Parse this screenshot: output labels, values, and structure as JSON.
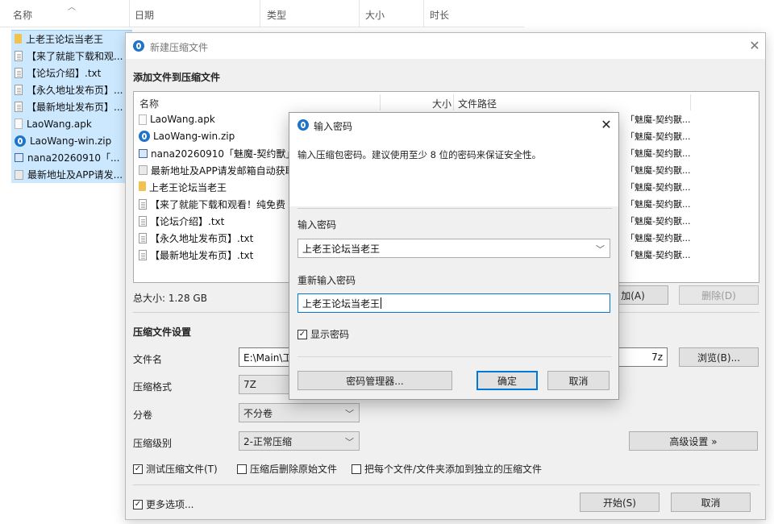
{
  "explorer": {
    "columns": [
      "名称",
      "日期",
      "类型",
      "大小",
      "时长"
    ],
    "files": [
      {
        "name": "上老王论坛当老王",
        "icon": "folder-icon"
      },
      {
        "name": "【来了就能下载和观...",
        "icon": "text-file-icon"
      },
      {
        "name": "【论坛介绍】.txt",
        "icon": "text-file-icon"
      },
      {
        "name": "【永久地址发布页】...",
        "icon": "text-file-icon"
      },
      {
        "name": "【最新地址发布页】...",
        "icon": "text-file-icon"
      },
      {
        "name": "LaoWang.apk",
        "icon": "apk-file-icon"
      },
      {
        "name": "LaoWang-win.zip",
        "icon": "zip-icon"
      },
      {
        "name": "nana20260910「...",
        "icon": "image-file-icon"
      },
      {
        "name": "最新地址及APP请发...",
        "icon": "image-file-icon"
      }
    ]
  },
  "main_window": {
    "title": "新建压缩文件",
    "add_files_heading": "添加文件到压缩文件",
    "list_columns": {
      "name": "名称",
      "size": "大小",
      "path": "文件路径"
    },
    "files": [
      {
        "name": "LaoWang.apk",
        "path": "「魅魔-契约獸...",
        "icon": "apk-file-icon"
      },
      {
        "name": "LaoWang-win.zip",
        "path": "「魅魔-契约獸...",
        "icon": "zip-icon"
      },
      {
        "name": "nana20260910「魅魔-契约獸」",
        "path": "「魅魔-契约獸...",
        "icon": "image-file-icon"
      },
      {
        "name": "最新地址及APP请发邮箱自动获取",
        "path": "「魅魔-契约獸...",
        "icon": "image-file-icon"
      },
      {
        "name": "上老王论坛当老王",
        "path": "「魅魔-契约獸...",
        "icon": "folder-icon"
      },
      {
        "name": "【来了就能下载和观看！纯免费",
        "path": "「魅魔-契约獸...",
        "icon": "text-file-icon"
      },
      {
        "name": "【论坛介绍】.txt",
        "path": "「魅魔-契约獸...",
        "icon": "text-file-icon"
      },
      {
        "name": "【永久地址发布页】.txt",
        "path": "「魅魔-契约獸...",
        "icon": "text-file-icon"
      },
      {
        "name": "【最新地址发布页】.txt",
        "path": "「魅魔-契约獸...",
        "icon": "text-file-icon"
      }
    ],
    "total_size": "总大小: 1.28 GB",
    "add_button": "加(A)",
    "delete_button": "删除(D)",
    "settings_heading": "压缩文件设置",
    "filename_label": "文件名",
    "filename_value": "E:\\Main\\工",
    "filename_value_tail": "7z",
    "browse_button": "浏览(B)...",
    "format_label": "压缩格式",
    "format_value": "7Z",
    "split_label": "分卷",
    "split_value": "不分卷",
    "level_label": "压缩级别",
    "level_value": "2-正常压缩",
    "advanced_button": "高级设置 »",
    "test_checkbox": "测试压缩文件(T)",
    "delete_source_checkbox": "压缩后删除原始文件",
    "each_separate_checkbox": "把每个文件/文件夹添加到独立的压缩文件",
    "more_options_checkbox": "更多选项...",
    "start_button": "开始(S)",
    "cancel_button": "取消"
  },
  "password_dialog": {
    "title": "输入密码",
    "info": "输入压缩包密码。建议使用至少 8 位的密码来保证安全性。",
    "password_label": "输入密码",
    "password_value": "上老王论坛当老王",
    "confirm_label": "重新输入密码",
    "confirm_value": "上老王论坛当老王",
    "show_password": "显示密码",
    "manager_button": "密码管理器...",
    "ok_button": "确定",
    "cancel_button": "取消"
  },
  "colors": {
    "selection": "#cce8ff",
    "accent": "#0078d7",
    "app_logo": "#1d74c9",
    "folder": "#f2c557"
  }
}
